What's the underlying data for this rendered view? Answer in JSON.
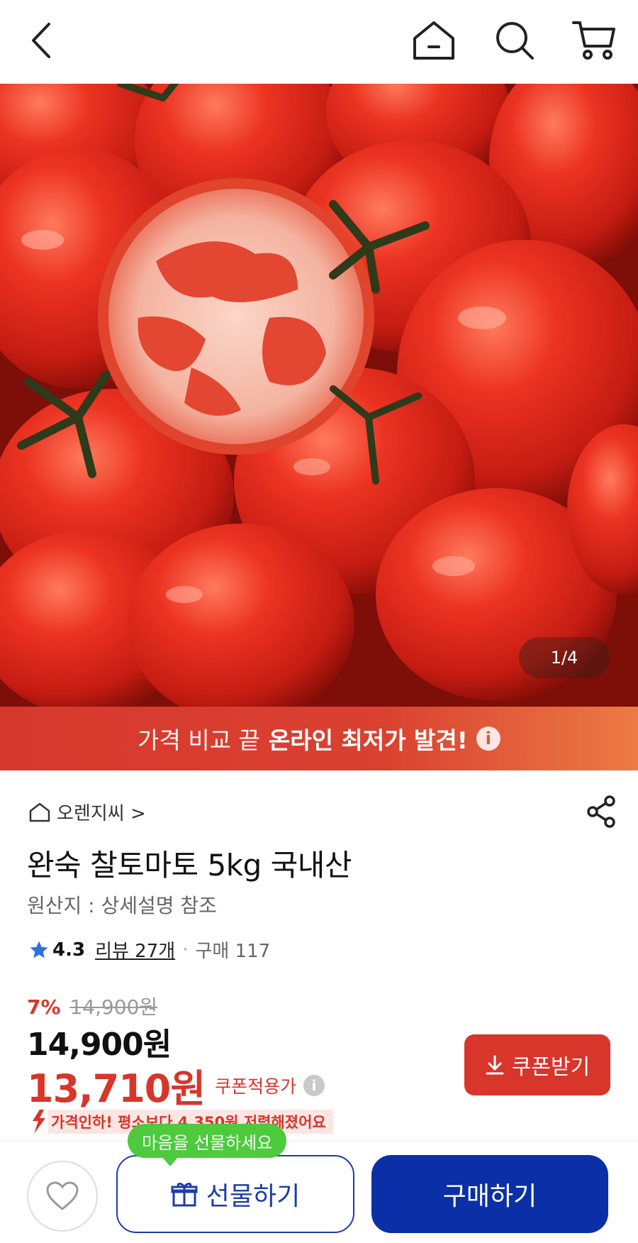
{
  "header": {
    "back_icon": "chevron-left-icon",
    "home_icon": "home-icon",
    "search_icon": "search-icon",
    "cart_icon": "cart-icon"
  },
  "gallery": {
    "pager": "1/4"
  },
  "promo_banner": {
    "lead": "가격 비교 끝",
    "highlight": "온라인 최저가 발견!",
    "info": "i"
  },
  "product": {
    "seller": "오렌지씨 >",
    "title": "완숙 찰토마토 5kg 국내산",
    "origin": "원산지 : 상세설명 참조",
    "rating": "4.3",
    "reviews": "리뷰 27개",
    "separator": "·",
    "sales": "구매 117"
  },
  "pricing": {
    "discount_pct": "7%",
    "original_price": "14,900원",
    "price": "14,900원",
    "coupon_price": "13,710원",
    "coupon_label": "쿠폰적용가",
    "coupon_button": "쿠폰받기",
    "price_drop": "가격인하! 평소보다 4,350원 저렴해졌어요"
  },
  "bottom": {
    "tooltip": "마음을 선물하세요",
    "gift_button": "선물하기",
    "buy_button": "구매하기"
  },
  "colors": {
    "accent_red": "#d8352b",
    "brand_blue": "#0b2fa6",
    "tooltip_green": "#4dca3d"
  }
}
